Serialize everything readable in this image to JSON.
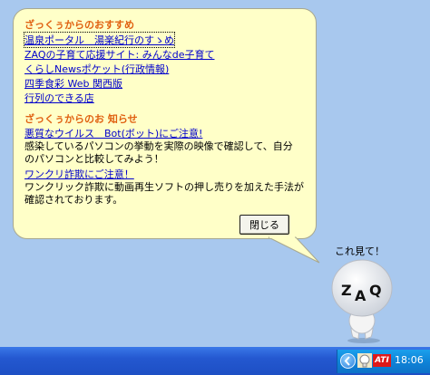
{
  "balloon": {
    "section1_heading": "ざっくぅからのおすすめ",
    "links1": [
      "温泉ポータル　湯楽紀行のすゝめ",
      "ZAQの子育て応援サイト: みんなde子育て",
      "くらしNewsポケット(行政情報)",
      "四季食彩 Web 関西版",
      "行列のできる店"
    ],
    "section2_heading": "ざっくぅからのお 知らせ",
    "notice1_link": "悪質なウイルス　Bot(ボット)にご注意!",
    "notice1_text": [
      "感染しているパソコンの挙動を実際の映像で確認して、自分",
      "のパソコンと比較してみよう！"
    ],
    "notice2_link": "ワンクリ詐欺にご注意！",
    "notice2_text": [
      "ワンクリック詐欺に動画再生ソフトの押し売りを加えた手法が",
      "確認されております。"
    ],
    "close_label": "閉じる"
  },
  "mascot": {
    "speech": "これ見て！",
    "face_letters": "ZAQ"
  },
  "taskbar": {
    "tray_icons": [
      "show-hidden-icons-arrow",
      "zaq-tray-icon",
      "ati-tray-icon"
    ],
    "ati_label": "ATI",
    "clock": "18:06"
  },
  "colors": {
    "desktop": "#a8c8ee",
    "balloon": "#ffffc8",
    "heading": "#e06010",
    "link": "#0000cc",
    "taskbar": "#2458d0",
    "tray": "#0f84d8"
  }
}
